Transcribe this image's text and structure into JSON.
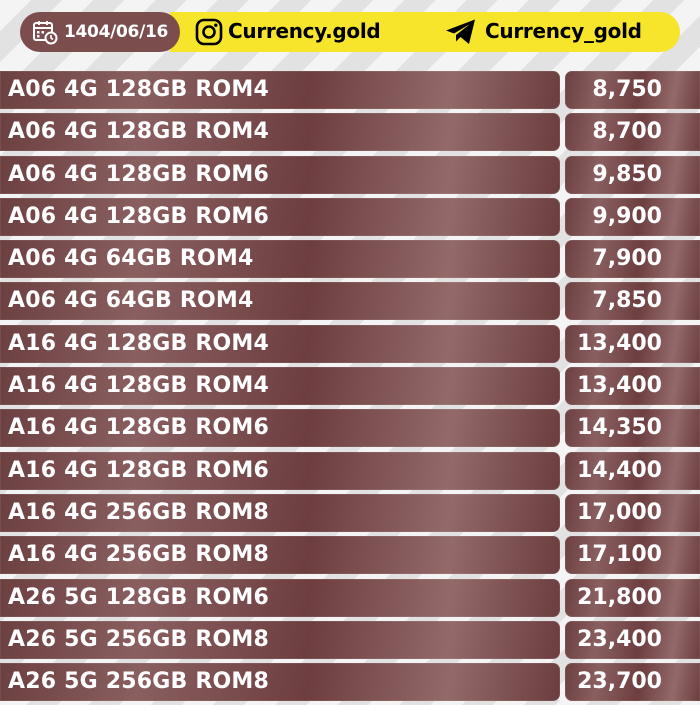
{
  "header": {
    "date": "1404/06/16",
    "instagram_handle": "Currency.gold",
    "telegram_handle": "Currency_gold",
    "colors": {
      "date_pill": "#7b4d4d",
      "social_bar": "#f6e52a",
      "row": "#7a4c4d"
    }
  },
  "rows": [
    {
      "model": "A06 4G 128GB ROM4",
      "price": "8,750"
    },
    {
      "model": "A06 4G 128GB ROM4",
      "price": "8,700"
    },
    {
      "model": "A06 4G 128GB ROM6",
      "price": "9,850"
    },
    {
      "model": "A06 4G 128GB ROM6",
      "price": "9,900"
    },
    {
      "model": "A06 4G 64GB ROM4",
      "price": "7,900"
    },
    {
      "model": "A06 4G 64GB ROM4",
      "price": "7,850"
    },
    {
      "model": "A16 4G 128GB ROM4",
      "price": "13,400"
    },
    {
      "model": "A16 4G 128GB ROM4",
      "price": "13,400"
    },
    {
      "model": "A16 4G 128GB ROM6",
      "price": "14,350"
    },
    {
      "model": "A16 4G 128GB ROM6",
      "price": "14,400"
    },
    {
      "model": "A16 4G 256GB ROM8",
      "price": "17,000"
    },
    {
      "model": "A16 4G 256GB ROM8",
      "price": "17,100"
    },
    {
      "model": "A26 5G 128GB ROM6",
      "price": "21,800"
    },
    {
      "model": "A26 5G 256GB ROM8",
      "price": "23,400"
    },
    {
      "model": "A26 5G 256GB ROM8",
      "price": "23,700"
    }
  ]
}
